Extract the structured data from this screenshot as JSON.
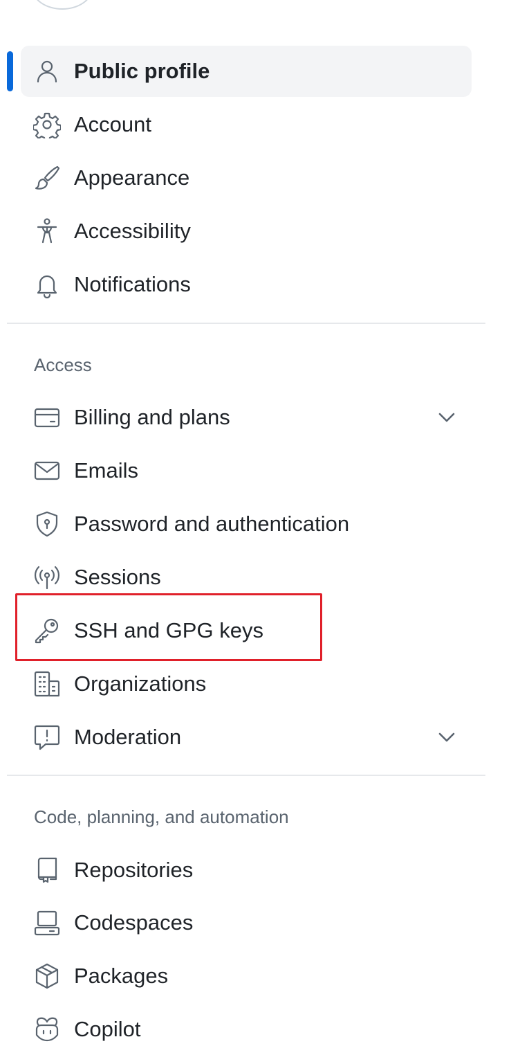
{
  "nav": {
    "selected_indicator_color": "#0969da",
    "items_top": [
      {
        "label": "Public profile",
        "icon": "person-icon",
        "selected": true
      },
      {
        "label": "Account",
        "icon": "gear-icon"
      },
      {
        "label": "Appearance",
        "icon": "paintbrush-icon"
      },
      {
        "label": "Accessibility",
        "icon": "accessibility-icon"
      },
      {
        "label": "Notifications",
        "icon": "bell-icon"
      }
    ],
    "access": {
      "heading": "Access",
      "items": [
        {
          "label": "Billing and plans",
          "icon": "credit-card-icon",
          "expandable": true
        },
        {
          "label": "Emails",
          "icon": "mail-icon"
        },
        {
          "label": "Password and authentication",
          "icon": "shield-lock-icon"
        },
        {
          "label": "Sessions",
          "icon": "broadcast-icon"
        },
        {
          "label": "SSH and GPG keys",
          "icon": "key-icon",
          "highlighted": true
        },
        {
          "label": "Organizations",
          "icon": "organization-icon"
        },
        {
          "label": "Moderation",
          "icon": "report-icon",
          "expandable": true
        }
      ]
    },
    "code": {
      "heading": "Code, planning, and automation",
      "items": [
        {
          "label": "Repositories",
          "icon": "repo-icon"
        },
        {
          "label": "Codespaces",
          "icon": "codespaces-icon"
        },
        {
          "label": "Packages",
          "icon": "package-icon"
        },
        {
          "label": "Copilot",
          "icon": "copilot-icon"
        }
      ]
    }
  },
  "annotation": {
    "highlight_color": "#e0202a"
  }
}
